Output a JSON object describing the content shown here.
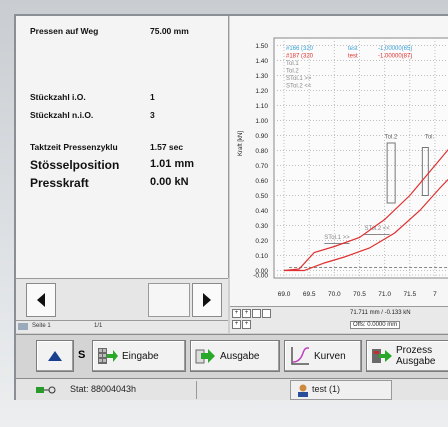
{
  "info": {
    "pressen_label": "Pressen auf Weg",
    "pressen_value": "75.00 mm",
    "io_label": "Stückzahl i.O.",
    "io_value": "1",
    "nio_label": "Stückzahl n.i.O.",
    "nio_value": "3",
    "takt_label": "Taktzeit Pressenzyklu",
    "takt_value": "1.57 sec",
    "stoessel_label": "Stösselposition",
    "stoessel_value": "1.01 mm",
    "kraft_label": "Presskraft",
    "kraft_value": "0.00 kN"
  },
  "pagebar": {
    "seite": "Seite 1",
    "of": "1/1"
  },
  "chart": {
    "ylabel": "Kraft [kN]",
    "legend": [
      {
        "text": "#166 (320",
        "color": "#3aa0d8",
        "extra": "test",
        "val": "-1.00000(65)"
      },
      {
        "text": "#187 (320",
        "color": "#e03030",
        "extra": "test",
        "val": "-1.00000(87)"
      },
      {
        "text": "Tol.1",
        "color": "#888888"
      },
      {
        "text": "Tol.2",
        "color": "#888888"
      },
      {
        "text": "STol.1 >>",
        "color": "#888888"
      },
      {
        "text": "STol.2 <<",
        "color": "#888888"
      }
    ],
    "annot_tol2": "Tol.2",
    "annot_tol1": "Tol.",
    "annot_stol1": "STol.1 >>",
    "annot_stol2": "STol.2 <<",
    "readout": "71.711 mm / -0.133 kN",
    "offs": "Offs: 0.0000 mm"
  },
  "chart_data": {
    "type": "line",
    "ylabel": "Kraft [kN]",
    "xlim": [
      68.8,
      72.3
    ],
    "ylim": [
      -0.05,
      1.55
    ],
    "xticks": [
      "69.0",
      "69.5",
      "70.0",
      "70.5",
      "71.0",
      "71.5",
      "7"
    ],
    "yticks": [
      "1.50",
      "1.40",
      "1.30",
      "1.20",
      "1.10",
      "1.00",
      "0.90",
      "0.80",
      "0.70",
      "0.60",
      "0.50",
      "0.40",
      "0.30",
      "0.20",
      "0.10",
      "0.00",
      "-0.00"
    ],
    "grid": true,
    "series": [
      {
        "name": "#166 (320",
        "color": "#e03030",
        "x": [
          69.0,
          69.3,
          69.6,
          70.0,
          70.5,
          71.0,
          71.5,
          72.0,
          72.3
        ],
        "y": [
          0.0,
          0.01,
          0.12,
          0.16,
          0.22,
          0.34,
          0.5,
          0.7,
          0.82
        ]
      },
      {
        "name": "#187 (320",
        "color": "#e03030",
        "x": [
          69.0,
          69.4,
          69.8,
          70.2,
          70.7,
          71.2,
          71.7,
          72.1,
          72.3
        ],
        "y": [
          0.0,
          0.0,
          0.05,
          0.09,
          0.15,
          0.25,
          0.4,
          0.55,
          0.62
        ]
      }
    ]
  },
  "buttons": {
    "s_label": "S",
    "eingabe": "Eingabe",
    "ausgabe": "Ausgabe",
    "kurven": "Kurven",
    "prozess_1": "Prozess",
    "prozess_2": "Ausgabe"
  },
  "status": {
    "stat": "Stat: 88004043h",
    "user": "test (1)"
  }
}
